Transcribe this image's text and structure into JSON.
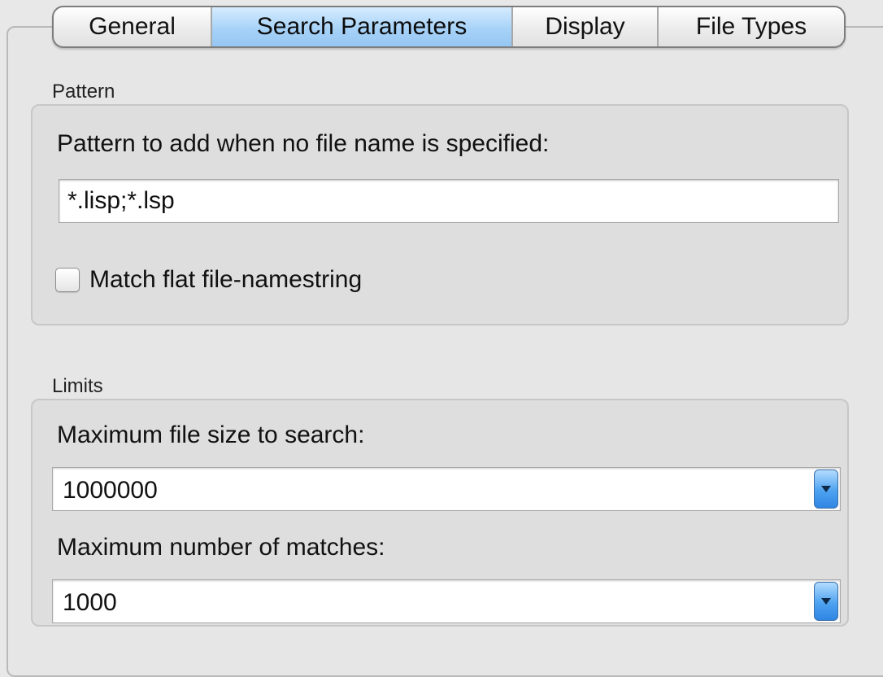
{
  "tabs": {
    "general": "General",
    "search_parameters": "Search Parameters",
    "display": "Display",
    "file_types": "File Types",
    "active": "Search Parameters"
  },
  "pattern": {
    "section_label": "Pattern",
    "field_label": "Pattern to add when no file name is specified:",
    "value": "*.lisp;*.lsp",
    "checkbox_label": "Match flat file-namestring",
    "checkbox_checked": false
  },
  "limits": {
    "section_label": "Limits",
    "max_file_size_label": "Maximum file size to search:",
    "max_file_size_value": "1000000",
    "max_matches_label": "Maximum number of matches:",
    "max_matches_value": "1000"
  },
  "icons": {
    "combo_arrow": "chevron-down-icon"
  },
  "colors": {
    "active_tab": "#a7d2f8",
    "combo_button": "#4ea2f0"
  }
}
